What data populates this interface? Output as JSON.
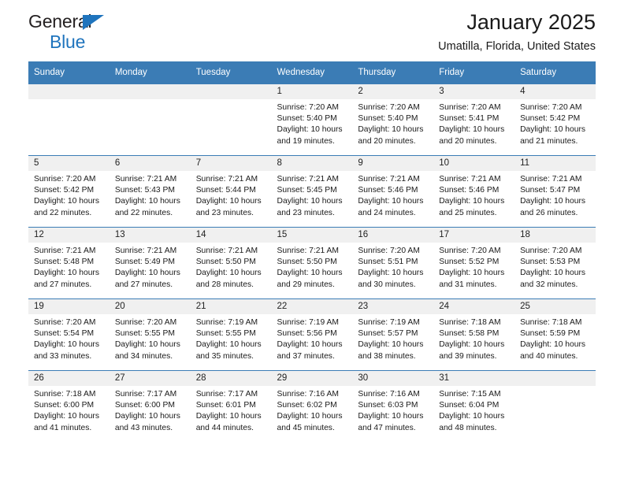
{
  "brand": {
    "line1": "General",
    "line2": "Blue",
    "triangle_color": "#1f74bd",
    "text_color": "#231f20"
  },
  "header": {
    "title": "January 2025",
    "subtitle": "Umatilla, Florida, United States"
  },
  "theme": {
    "header_blue": "#3b7cb5",
    "daynum_bg": "#f0f0f0",
    "text": "#1a1a1a"
  },
  "weekday_headers": [
    "Sunday",
    "Monday",
    "Tuesday",
    "Wednesday",
    "Thursday",
    "Friday",
    "Saturday"
  ],
  "labels": {
    "sunrise_prefix": "Sunrise:",
    "sunset_prefix": "Sunset:",
    "daylight_prefix": "Daylight:"
  },
  "weeks": [
    [
      {
        "day": "",
        "empty": true,
        "sunrise": "",
        "sunset": "",
        "daylight_line1": "",
        "daylight_line2": ""
      },
      {
        "day": "",
        "empty": true,
        "sunrise": "",
        "sunset": "",
        "daylight_line1": "",
        "daylight_line2": ""
      },
      {
        "day": "",
        "empty": true,
        "sunrise": "",
        "sunset": "",
        "daylight_line1": "",
        "daylight_line2": ""
      },
      {
        "day": "1",
        "empty": false,
        "sunrise": "Sunrise: 7:20 AM",
        "sunset": "Sunset: 5:40 PM",
        "daylight_line1": "Daylight: 10 hours",
        "daylight_line2": "and 19 minutes."
      },
      {
        "day": "2",
        "empty": false,
        "sunrise": "Sunrise: 7:20 AM",
        "sunset": "Sunset: 5:40 PM",
        "daylight_line1": "Daylight: 10 hours",
        "daylight_line2": "and 20 minutes."
      },
      {
        "day": "3",
        "empty": false,
        "sunrise": "Sunrise: 7:20 AM",
        "sunset": "Sunset: 5:41 PM",
        "daylight_line1": "Daylight: 10 hours",
        "daylight_line2": "and 20 minutes."
      },
      {
        "day": "4",
        "empty": false,
        "sunrise": "Sunrise: 7:20 AM",
        "sunset": "Sunset: 5:42 PM",
        "daylight_line1": "Daylight: 10 hours",
        "daylight_line2": "and 21 minutes."
      }
    ],
    [
      {
        "day": "5",
        "empty": false,
        "sunrise": "Sunrise: 7:20 AM",
        "sunset": "Sunset: 5:42 PM",
        "daylight_line1": "Daylight: 10 hours",
        "daylight_line2": "and 22 minutes."
      },
      {
        "day": "6",
        "empty": false,
        "sunrise": "Sunrise: 7:21 AM",
        "sunset": "Sunset: 5:43 PM",
        "daylight_line1": "Daylight: 10 hours",
        "daylight_line2": "and 22 minutes."
      },
      {
        "day": "7",
        "empty": false,
        "sunrise": "Sunrise: 7:21 AM",
        "sunset": "Sunset: 5:44 PM",
        "daylight_line1": "Daylight: 10 hours",
        "daylight_line2": "and 23 minutes."
      },
      {
        "day": "8",
        "empty": false,
        "sunrise": "Sunrise: 7:21 AM",
        "sunset": "Sunset: 5:45 PM",
        "daylight_line1": "Daylight: 10 hours",
        "daylight_line2": "and 23 minutes."
      },
      {
        "day": "9",
        "empty": false,
        "sunrise": "Sunrise: 7:21 AM",
        "sunset": "Sunset: 5:46 PM",
        "daylight_line1": "Daylight: 10 hours",
        "daylight_line2": "and 24 minutes."
      },
      {
        "day": "10",
        "empty": false,
        "sunrise": "Sunrise: 7:21 AM",
        "sunset": "Sunset: 5:46 PM",
        "daylight_line1": "Daylight: 10 hours",
        "daylight_line2": "and 25 minutes."
      },
      {
        "day": "11",
        "empty": false,
        "sunrise": "Sunrise: 7:21 AM",
        "sunset": "Sunset: 5:47 PM",
        "daylight_line1": "Daylight: 10 hours",
        "daylight_line2": "and 26 minutes."
      }
    ],
    [
      {
        "day": "12",
        "empty": false,
        "sunrise": "Sunrise: 7:21 AM",
        "sunset": "Sunset: 5:48 PM",
        "daylight_line1": "Daylight: 10 hours",
        "daylight_line2": "and 27 minutes."
      },
      {
        "day": "13",
        "empty": false,
        "sunrise": "Sunrise: 7:21 AM",
        "sunset": "Sunset: 5:49 PM",
        "daylight_line1": "Daylight: 10 hours",
        "daylight_line2": "and 27 minutes."
      },
      {
        "day": "14",
        "empty": false,
        "sunrise": "Sunrise: 7:21 AM",
        "sunset": "Sunset: 5:50 PM",
        "daylight_line1": "Daylight: 10 hours",
        "daylight_line2": "and 28 minutes."
      },
      {
        "day": "15",
        "empty": false,
        "sunrise": "Sunrise: 7:21 AM",
        "sunset": "Sunset: 5:50 PM",
        "daylight_line1": "Daylight: 10 hours",
        "daylight_line2": "and 29 minutes."
      },
      {
        "day": "16",
        "empty": false,
        "sunrise": "Sunrise: 7:20 AM",
        "sunset": "Sunset: 5:51 PM",
        "daylight_line1": "Daylight: 10 hours",
        "daylight_line2": "and 30 minutes."
      },
      {
        "day": "17",
        "empty": false,
        "sunrise": "Sunrise: 7:20 AM",
        "sunset": "Sunset: 5:52 PM",
        "daylight_line1": "Daylight: 10 hours",
        "daylight_line2": "and 31 minutes."
      },
      {
        "day": "18",
        "empty": false,
        "sunrise": "Sunrise: 7:20 AM",
        "sunset": "Sunset: 5:53 PM",
        "daylight_line1": "Daylight: 10 hours",
        "daylight_line2": "and 32 minutes."
      }
    ],
    [
      {
        "day": "19",
        "empty": false,
        "sunrise": "Sunrise: 7:20 AM",
        "sunset": "Sunset: 5:54 PM",
        "daylight_line1": "Daylight: 10 hours",
        "daylight_line2": "and 33 minutes."
      },
      {
        "day": "20",
        "empty": false,
        "sunrise": "Sunrise: 7:20 AM",
        "sunset": "Sunset: 5:55 PM",
        "daylight_line1": "Daylight: 10 hours",
        "daylight_line2": "and 34 minutes."
      },
      {
        "day": "21",
        "empty": false,
        "sunrise": "Sunrise: 7:19 AM",
        "sunset": "Sunset: 5:55 PM",
        "daylight_line1": "Daylight: 10 hours",
        "daylight_line2": "and 35 minutes."
      },
      {
        "day": "22",
        "empty": false,
        "sunrise": "Sunrise: 7:19 AM",
        "sunset": "Sunset: 5:56 PM",
        "daylight_line1": "Daylight: 10 hours",
        "daylight_line2": "and 37 minutes."
      },
      {
        "day": "23",
        "empty": false,
        "sunrise": "Sunrise: 7:19 AM",
        "sunset": "Sunset: 5:57 PM",
        "daylight_line1": "Daylight: 10 hours",
        "daylight_line2": "and 38 minutes."
      },
      {
        "day": "24",
        "empty": false,
        "sunrise": "Sunrise: 7:18 AM",
        "sunset": "Sunset: 5:58 PM",
        "daylight_line1": "Daylight: 10 hours",
        "daylight_line2": "and 39 minutes."
      },
      {
        "day": "25",
        "empty": false,
        "sunrise": "Sunrise: 7:18 AM",
        "sunset": "Sunset: 5:59 PM",
        "daylight_line1": "Daylight: 10 hours",
        "daylight_line2": "and 40 minutes."
      }
    ],
    [
      {
        "day": "26",
        "empty": false,
        "sunrise": "Sunrise: 7:18 AM",
        "sunset": "Sunset: 6:00 PM",
        "daylight_line1": "Daylight: 10 hours",
        "daylight_line2": "and 41 minutes."
      },
      {
        "day": "27",
        "empty": false,
        "sunrise": "Sunrise: 7:17 AM",
        "sunset": "Sunset: 6:00 PM",
        "daylight_line1": "Daylight: 10 hours",
        "daylight_line2": "and 43 minutes."
      },
      {
        "day": "28",
        "empty": false,
        "sunrise": "Sunrise: 7:17 AM",
        "sunset": "Sunset: 6:01 PM",
        "daylight_line1": "Daylight: 10 hours",
        "daylight_line2": "and 44 minutes."
      },
      {
        "day": "29",
        "empty": false,
        "sunrise": "Sunrise: 7:16 AM",
        "sunset": "Sunset: 6:02 PM",
        "daylight_line1": "Daylight: 10 hours",
        "daylight_line2": "and 45 minutes."
      },
      {
        "day": "30",
        "empty": false,
        "sunrise": "Sunrise: 7:16 AM",
        "sunset": "Sunset: 6:03 PM",
        "daylight_line1": "Daylight: 10 hours",
        "daylight_line2": "and 47 minutes."
      },
      {
        "day": "31",
        "empty": false,
        "sunrise": "Sunrise: 7:15 AM",
        "sunset": "Sunset: 6:04 PM",
        "daylight_line1": "Daylight: 10 hours",
        "daylight_line2": "and 48 minutes."
      },
      {
        "day": "",
        "empty": true,
        "sunrise": "",
        "sunset": "",
        "daylight_line1": "",
        "daylight_line2": ""
      }
    ]
  ]
}
